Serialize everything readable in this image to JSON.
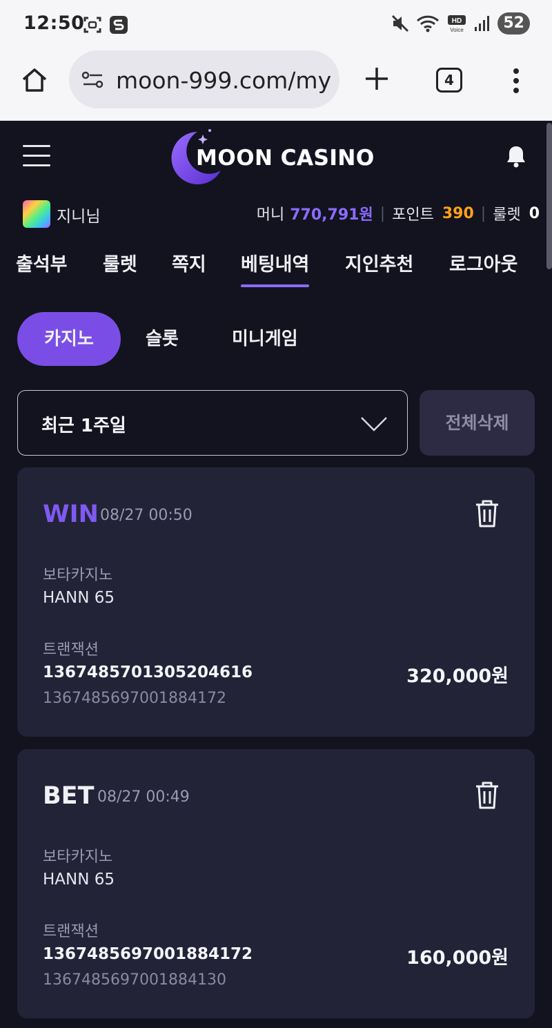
{
  "status_bar": {
    "time": "12:50",
    "battery": "52",
    "icons": [
      "screenshot-icon",
      "s-app-icon",
      "mute-icon",
      "wifi-icon",
      "hd-voice-icon",
      "signal-icon"
    ]
  },
  "browser": {
    "url": "moon-999.com/my",
    "tab_count": "4"
  },
  "site": {
    "logo_moon": "MOON",
    "logo_casino": "CASINO",
    "colors": {
      "accent": "#7f5af0",
      "bg": "#13131f",
      "card": "#222337",
      "point": "#ffa21a"
    }
  },
  "user": {
    "name": "지니님",
    "money_label": "머니",
    "money_value": "770,791원",
    "point_label": "포인트",
    "point_value": "390",
    "roulette_label": "룰렛",
    "roulette_value": "0"
  },
  "nav_tabs": [
    {
      "label": "출석부"
    },
    {
      "label": "룰렛"
    },
    {
      "label": "쪽지"
    },
    {
      "label": "베팅내역",
      "active": true
    },
    {
      "label": "지인추천"
    },
    {
      "label": "로그아웃"
    }
  ],
  "game_types": [
    {
      "label": "카지노",
      "active": true
    },
    {
      "label": "슬롯"
    },
    {
      "label": "미니게임"
    }
  ],
  "filter": {
    "period": "최근 1주일",
    "delete_all": "전체삭제"
  },
  "bets": [
    {
      "status": "WIN",
      "date": "08/27 00:50",
      "provider": "보타카지노",
      "game": "HANN 65",
      "tx_label": "트랜잭션",
      "tx_id": "1367485701305204616",
      "tx_ref": "1367485697001884172",
      "amount": "320,000원"
    },
    {
      "status": "BET",
      "date": "08/27 00:49",
      "provider": "보타카지노",
      "game": "HANN 65",
      "tx_label": "트랜잭션",
      "tx_id": "1367485697001884172",
      "tx_ref": "1367485697001884130",
      "amount": "160,000원"
    }
  ]
}
